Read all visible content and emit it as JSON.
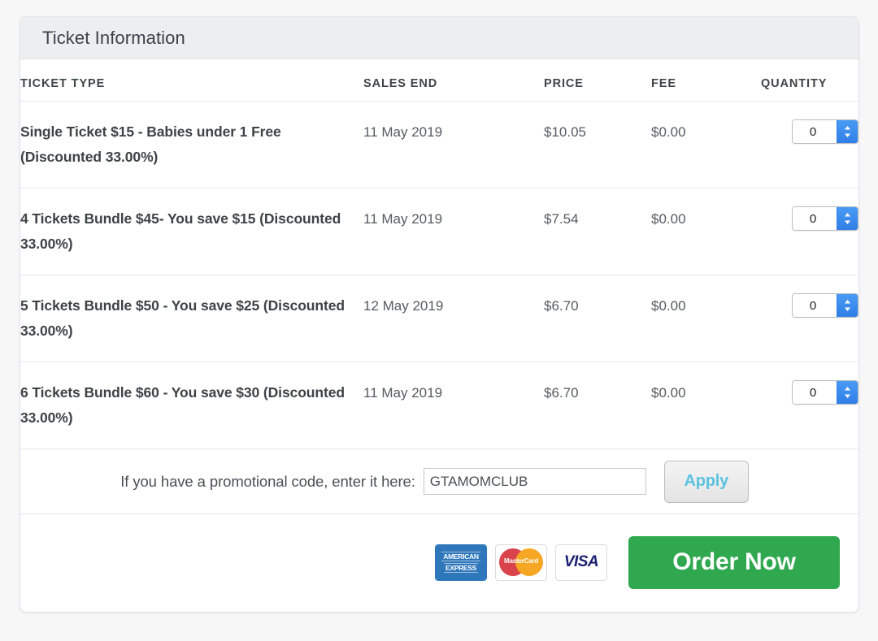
{
  "panel": {
    "title": "Ticket Information"
  },
  "table": {
    "headers": {
      "type": "TICKET TYPE",
      "sales_end": "SALES END",
      "price": "PRICE",
      "fee": "FEE",
      "quantity": "QUANTITY"
    },
    "rows": [
      {
        "type": "Single Ticket $15 - Babies under 1 Free (Discounted 33.00%)",
        "sales_end": "11 May 2019",
        "price": "$10.05",
        "fee": "$0.00",
        "quantity": "0"
      },
      {
        "type": "4 Tickets Bundle $45- You save $15 (Discounted 33.00%)",
        "sales_end": "11 May 2019",
        "price": "$7.54",
        "fee": "$0.00",
        "quantity": "0"
      },
      {
        "type": "5 Tickets Bundle $50 - You save $25 (Discounted 33.00%)",
        "sales_end": "12 May 2019",
        "price": "$6.70",
        "fee": "$0.00",
        "quantity": "0"
      },
      {
        "type": "6 Tickets Bundle $60 - You save $30 (Discounted 33.00%)",
        "sales_end": "11 May 2019",
        "price": "$6.70",
        "fee": "$0.00",
        "quantity": "0"
      }
    ]
  },
  "promo": {
    "label": "If you have a promotional code, enter it here:",
    "value": "GTAMOMCLUB",
    "placeholder": "",
    "apply_label": "Apply"
  },
  "footer": {
    "cards": [
      {
        "name": "american-express-icon",
        "line1": "AMERICAN",
        "line2": "EXPRESS"
      },
      {
        "name": "mastercard-icon",
        "label": "MasterCard"
      },
      {
        "name": "visa-icon",
        "label": "VISA"
      }
    ],
    "order_label": "Order Now"
  },
  "colors": {
    "header_bg": "#eceff1",
    "order_button": "#2fa84f",
    "apply_text": "#5bc3e0",
    "stepper_arrows": "#2f7fe8",
    "amex_blue": "#2e77bb",
    "mastercard_red": "#d9434b",
    "mastercard_yellow": "#f5a623",
    "visa_blue": "#1a1f71"
  }
}
